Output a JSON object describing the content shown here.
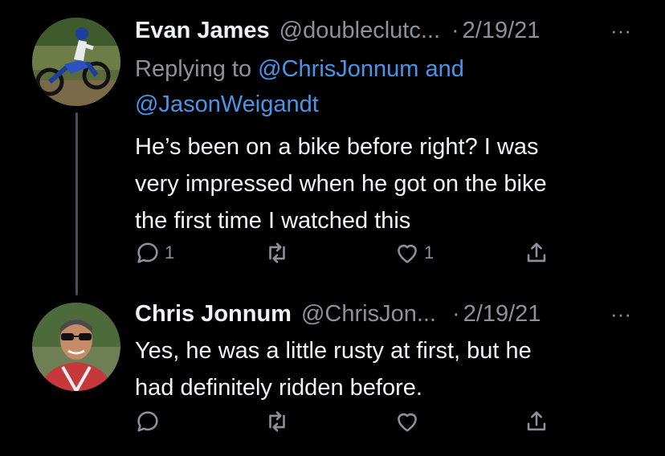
{
  "tweets": [
    {
      "author_name": "Evan James",
      "handle": "@doubleclutc...",
      "separator": "·",
      "date": "2/19/21",
      "more": "···",
      "replying_prefix": "Replying to ",
      "replying_mention_1": "@ChrisJonnum",
      "replying_and": " and",
      "replying_mention_2": "@JasonWeigandt",
      "text_lines": [
        "He’s been on a bike before right? I was",
        "very impressed when he got on the bike",
        "the first time I watched this"
      ],
      "reply_count": "1",
      "retweet_count": "",
      "like_count": "1",
      "avatar_icon": "motocross-rider-avatar"
    },
    {
      "author_name": "Chris Jonnum",
      "handle": "@ChrisJon...",
      "separator": "·",
      "date": "2/19/21",
      "more": "···",
      "text_lines": [
        "Yes, he was a little rusty at first, but he",
        "had definitely ridden before."
      ],
      "reply_count": "",
      "retweet_count": "",
      "like_count": "",
      "avatar_icon": "man-sunglasses-avatar"
    }
  ],
  "colors": {
    "background": "#000000",
    "text_primary": "#f2f3f4",
    "text_secondary": "#8b9299",
    "link": "#4a95e8",
    "thread_line": "#4a4f54"
  }
}
